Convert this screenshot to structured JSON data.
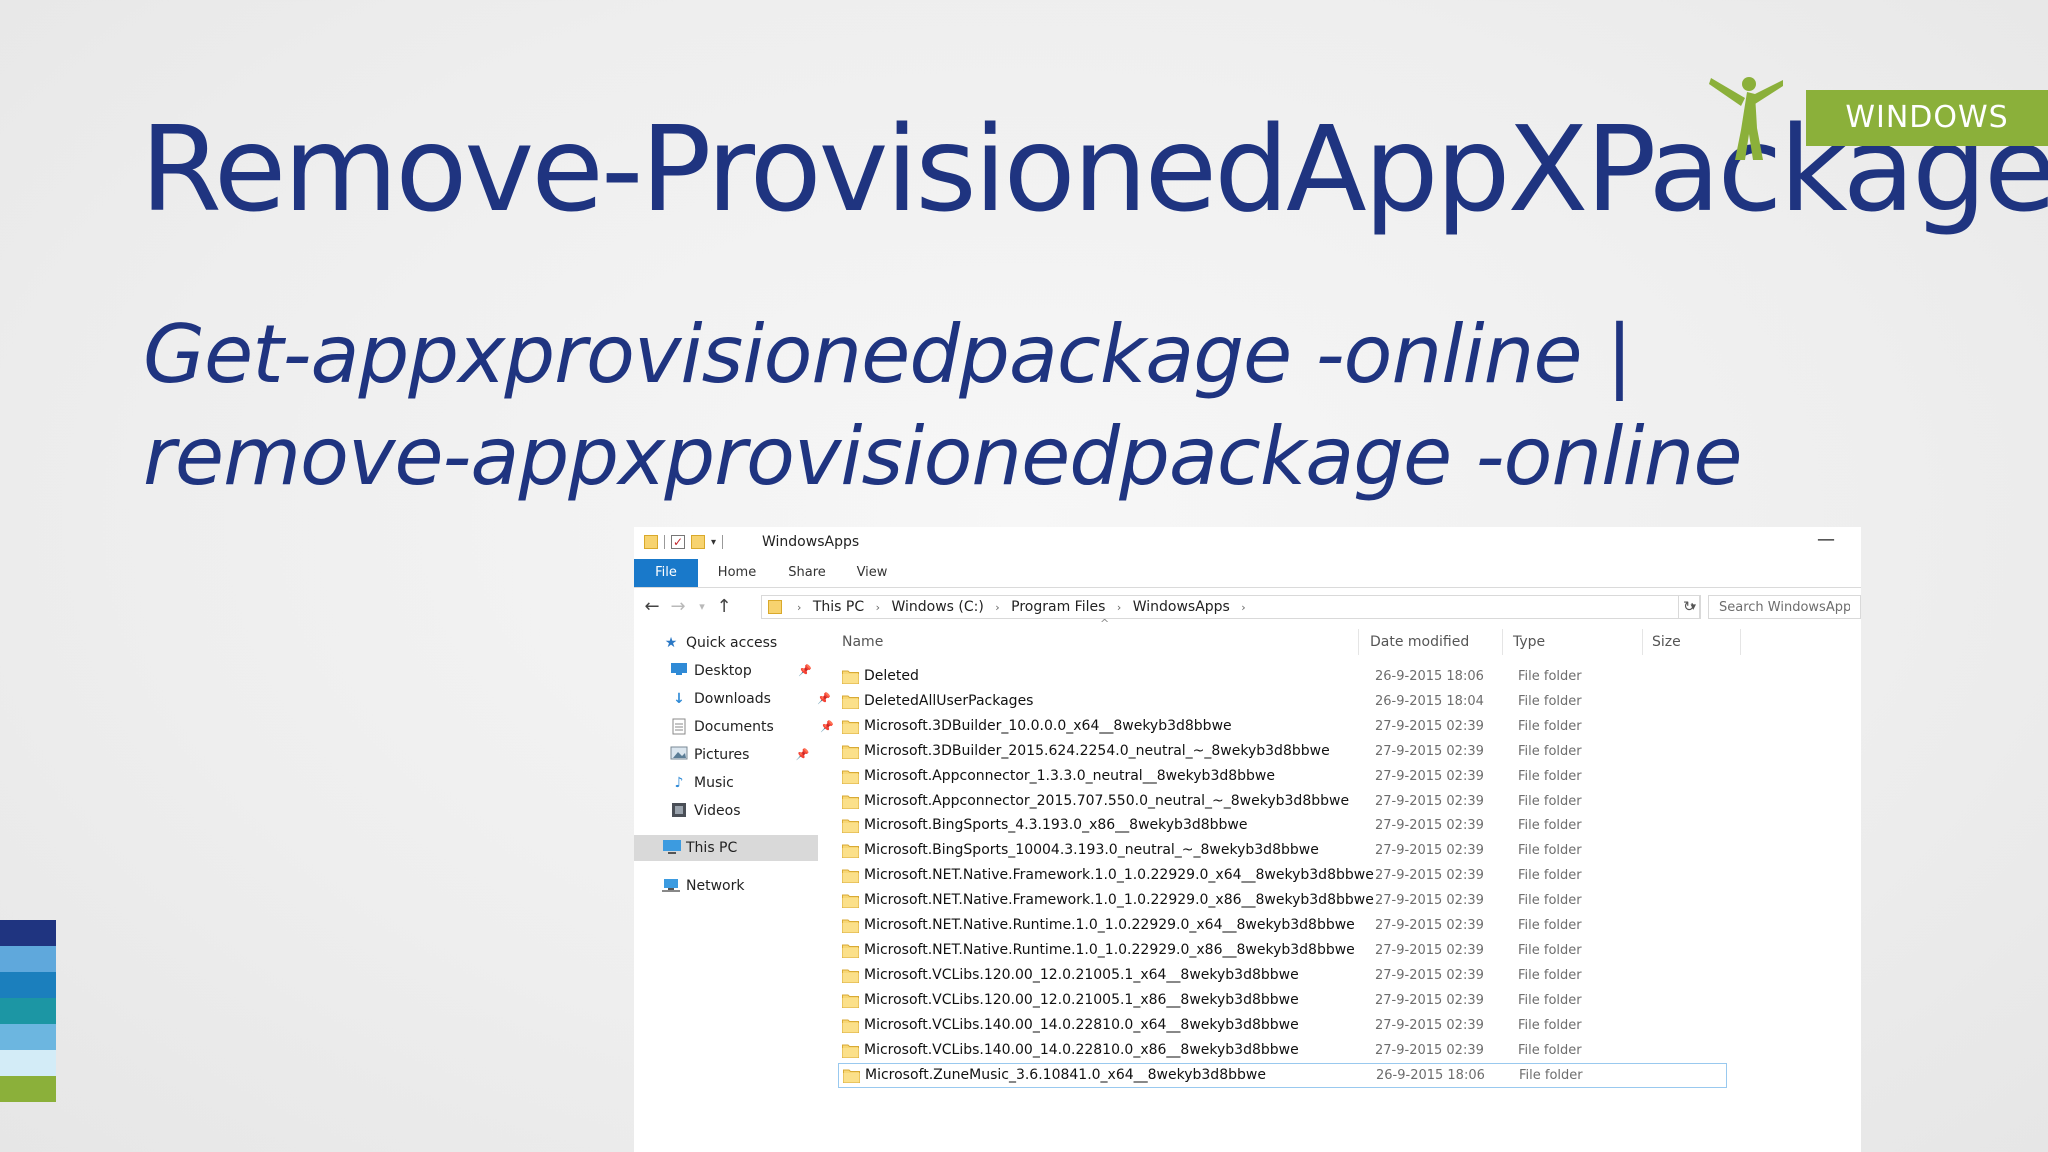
{
  "slide": {
    "title": "Remove-ProvisionedAppXPackage",
    "subtitle": "Get-appxprovisionedpackage -online | remove-appxprovisionedpackage -online",
    "brand_label": "WINDOWS"
  },
  "colors": {
    "title_blue": "#1f3480",
    "brand_green": "#8bb03a",
    "ribbon_file_blue": "#1979ca",
    "stripes": [
      "#1f3480",
      "#5fa8dc",
      "#1b7fbd",
      "#1c96a4",
      "#6cb6e0",
      "#d3ecf7",
      "#8bb03a"
    ]
  },
  "explorer": {
    "window_title": "WindowsApps",
    "ribbon_tabs": [
      "File",
      "Home",
      "Share",
      "View"
    ],
    "breadcrumbs": [
      "This PC",
      "Windows (C:)",
      "Program Files",
      "WindowsApps"
    ],
    "search_placeholder": "Search WindowsApps",
    "nav_items": [
      {
        "label": "Quick access",
        "icon": "star-icon",
        "pinned": false
      },
      {
        "label": "Desktop",
        "icon": "desktop-icon",
        "pinned": true
      },
      {
        "label": "Downloads",
        "icon": "download-icon",
        "pinned": true
      },
      {
        "label": "Documents",
        "icon": "documents-icon",
        "pinned": true
      },
      {
        "label": "Pictures",
        "icon": "pictures-icon",
        "pinned": true
      },
      {
        "label": "Music",
        "icon": "music-icon",
        "pinned": false
      },
      {
        "label": "Videos",
        "icon": "videos-icon",
        "pinned": false
      },
      {
        "label": "This PC",
        "icon": "computer-icon",
        "pinned": false,
        "selected": true
      },
      {
        "label": "Network",
        "icon": "network-icon",
        "pinned": false
      }
    ],
    "columns": [
      "Name",
      "Date modified",
      "Type",
      "Size"
    ],
    "files": [
      {
        "name": "Deleted",
        "date": "26-9-2015 18:06",
        "type": "File folder"
      },
      {
        "name": "DeletedAllUserPackages",
        "date": "26-9-2015 18:04",
        "type": "File folder"
      },
      {
        "name": "Microsoft.3DBuilder_10.0.0.0_x64__8wekyb3d8bbwe",
        "date": "27-9-2015 02:39",
        "type": "File folder"
      },
      {
        "name": "Microsoft.3DBuilder_2015.624.2254.0_neutral_~_8wekyb3d8bbwe",
        "date": "27-9-2015 02:39",
        "type": "File folder"
      },
      {
        "name": "Microsoft.Appconnector_1.3.3.0_neutral__8wekyb3d8bbwe",
        "date": "27-9-2015 02:39",
        "type": "File folder"
      },
      {
        "name": "Microsoft.Appconnector_2015.707.550.0_neutral_~_8wekyb3d8bbwe",
        "date": "27-9-2015 02:39",
        "type": "File folder"
      },
      {
        "name": "Microsoft.BingSports_4.3.193.0_x86__8wekyb3d8bbwe",
        "date": "27-9-2015 02:39",
        "type": "File folder"
      },
      {
        "name": "Microsoft.BingSports_10004.3.193.0_neutral_~_8wekyb3d8bbwe",
        "date": "27-9-2015 02:39",
        "type": "File folder"
      },
      {
        "name": "Microsoft.NET.Native.Framework.1.0_1.0.22929.0_x64__8wekyb3d8bbwe",
        "date": "27-9-2015 02:39",
        "type": "File folder"
      },
      {
        "name": "Microsoft.NET.Native.Framework.1.0_1.0.22929.0_x86__8wekyb3d8bbwe",
        "date": "27-9-2015 02:39",
        "type": "File folder"
      },
      {
        "name": "Microsoft.NET.Native.Runtime.1.0_1.0.22929.0_x64__8wekyb3d8bbwe",
        "date": "27-9-2015 02:39",
        "type": "File folder"
      },
      {
        "name": "Microsoft.NET.Native.Runtime.1.0_1.0.22929.0_x86__8wekyb3d8bbwe",
        "date": "27-9-2015 02:39",
        "type": "File folder"
      },
      {
        "name": "Microsoft.VCLibs.120.00_12.0.21005.1_x64__8wekyb3d8bbwe",
        "date": "27-9-2015 02:39",
        "type": "File folder"
      },
      {
        "name": "Microsoft.VCLibs.120.00_12.0.21005.1_x86__8wekyb3d8bbwe",
        "date": "27-9-2015 02:39",
        "type": "File folder"
      },
      {
        "name": "Microsoft.VCLibs.140.00_14.0.22810.0_x64__8wekyb3d8bbwe",
        "date": "27-9-2015 02:39",
        "type": "File folder"
      },
      {
        "name": "Microsoft.VCLibs.140.00_14.0.22810.0_x86__8wekyb3d8bbwe",
        "date": "27-9-2015 02:39",
        "type": "File folder"
      },
      {
        "name": "Microsoft.ZuneMusic_3.6.10841.0_x64__8wekyb3d8bbwe",
        "date": "26-9-2015 18:06",
        "type": "File folder",
        "selected": true
      }
    ]
  }
}
